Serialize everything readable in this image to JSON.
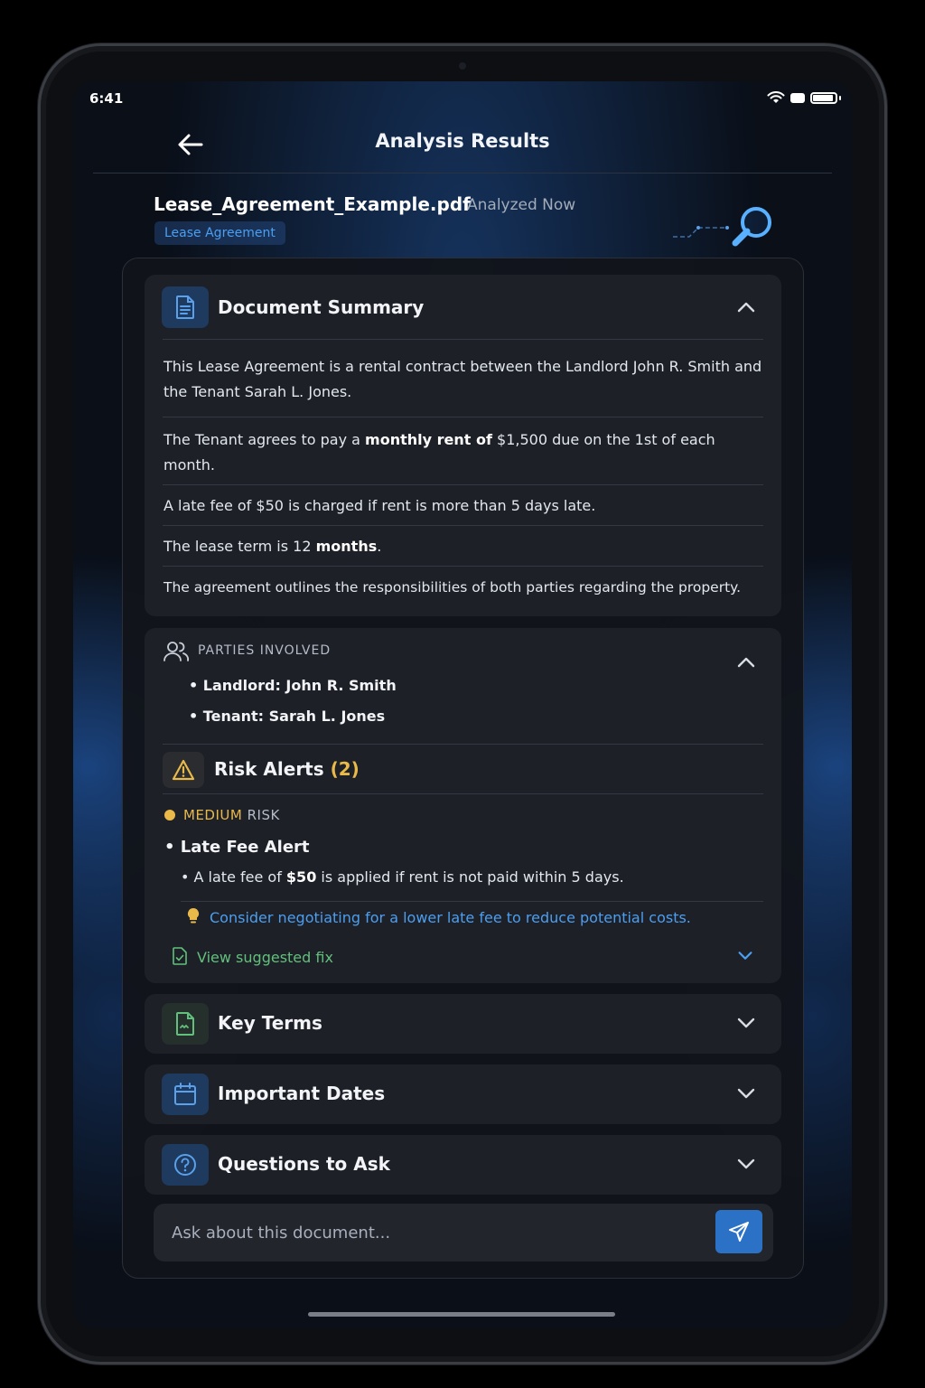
{
  "status_bar": {
    "time": "6:41"
  },
  "nav": {
    "title": "Analysis Results"
  },
  "document": {
    "filename": "Lease_Agreement_Example.pdf",
    "status": "Analyzed Now",
    "tag": "Lease Agreement"
  },
  "summary": {
    "title": "Document Summary",
    "p1": "This Lease Agreement is a rental contract between the Landlord John R. Smith and the Tenant Sarah L. Jones.",
    "p2_a": "The Tenant agrees to pay a ",
    "p2_b": "monthly rent of",
    "p2_c": " $1,500 due on the 1st of each month.",
    "p3": "A late fee of $50 is charged if rent is more than 5 days late.",
    "p4_a": "The lease term is 12 ",
    "p4_b": "months",
    "p4_c": ".",
    "p5": "The agreement outlines the responsibilities of both parties regarding the property."
  },
  "parties": {
    "label": "PARTIES INVOLVED",
    "landlord": "• Landlord: John R. Smith",
    "tenant": "• Tenant: Sarah L. Jones"
  },
  "risk": {
    "title": "Risk Alerts",
    "count": "(2)",
    "level_a": "MEDIUM",
    "level_b": " RISK",
    "alert_title": "• Late Fee Alert",
    "desc_a": "•  A late fee of ",
    "desc_b": "$50",
    "desc_c": "  is applied if rent is not paid within 5 days.",
    "tip": "Consider negotiating for a lower late fee to reduce potential costs.",
    "fix_label": "View suggested fix"
  },
  "sections": {
    "key_terms": "Key Terms",
    "important_dates": "Important Dates",
    "questions": "Questions to Ask"
  },
  "chat": {
    "placeholder": "Ask about this document..."
  },
  "colors": {
    "accent_blue": "#4c9ef0",
    "warning_yellow": "#e9b94a",
    "success_green": "#62c07c",
    "send_button": "#2b72c6"
  }
}
